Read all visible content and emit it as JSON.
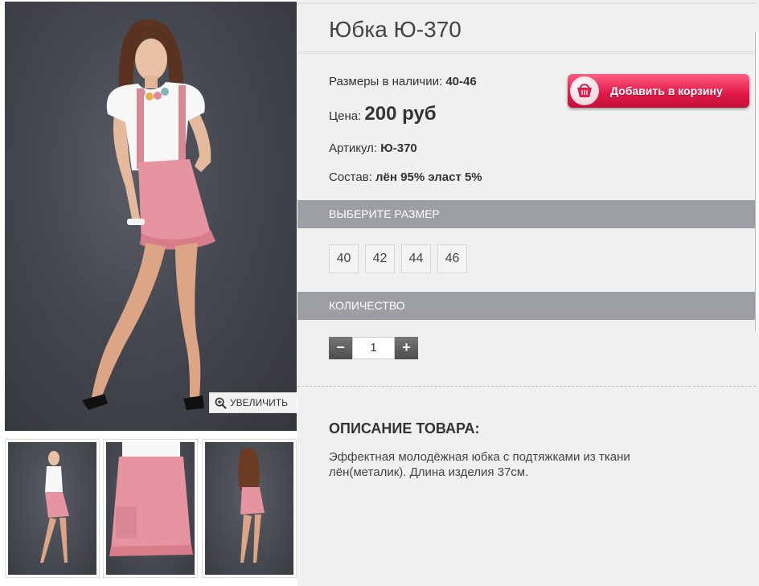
{
  "product": {
    "title": "Юбка Ю-370",
    "sizes_available_label": "Размеры в наличии:",
    "sizes_available_value": "40-46",
    "price_label": "Цена:",
    "price_value": "200 руб",
    "sku_label": "Артикул:",
    "sku_value": "Ю-370",
    "composition_label": "Состав:",
    "composition_value": "лён 95% эласт 5%"
  },
  "cart_button": {
    "label": "Добавить в корзину",
    "icon": "basket-icon"
  },
  "zoom_button": {
    "label": "УВЕЛИЧИТЬ",
    "icon": "zoom-in-icon"
  },
  "size_section": {
    "title": "ВЫБЕРИТЕ РАЗМЕР",
    "sizes": [
      "40",
      "42",
      "44",
      "46"
    ]
  },
  "quantity_section": {
    "title": "КОЛИЧЕСТВО",
    "value": "1",
    "minus": "−",
    "plus": "+"
  },
  "description": {
    "title": "ОПИСАНИЕ ТОВАРА:",
    "line1": "Эффектная молодёжная юбка с подтяжками из ткани",
    "line2": "лён(металик). Длина изделия 37см."
  },
  "colors": {
    "skirt": "#e6949f",
    "blouse": "#f7f7f7",
    "button": "#e21c4b",
    "bar": "#9b9ea3"
  }
}
